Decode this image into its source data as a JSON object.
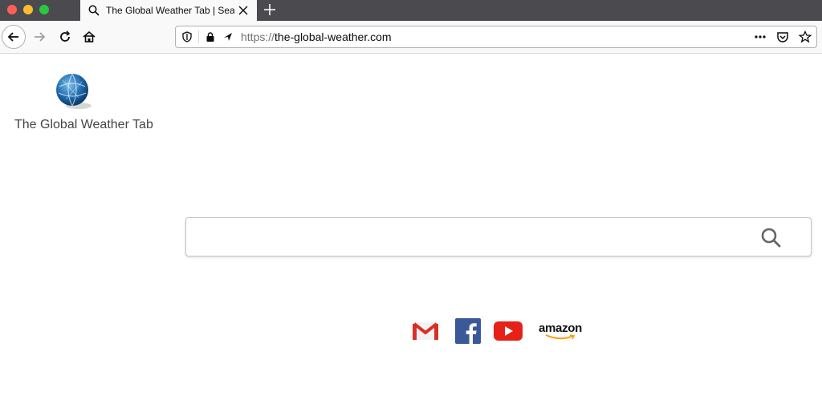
{
  "browser": {
    "tab": {
      "title": "The Global Weather Tab | Search",
      "icon": "search-icon"
    },
    "new_tab_icon": "plus-icon",
    "url": {
      "protocol": "https://",
      "host": "the-global-weather.com"
    },
    "nav_icons": [
      "back-arrow-icon",
      "forward-arrow-icon",
      "reload-icon",
      "home-icon"
    ],
    "url_icons": [
      "shield-icon",
      "lock-icon",
      "permissions-icon"
    ],
    "right_icons": [
      "more-actions-icon",
      "pocket-icon",
      "bookmark-star-icon"
    ]
  },
  "page": {
    "logo": {
      "name": "The Global Weather Tab",
      "icon": "globe-icon"
    },
    "search": {
      "placeholder": "",
      "value": "",
      "button_icon": "search-icon"
    },
    "shortcuts": [
      {
        "name": "Gmail",
        "icon": "gmail-icon",
        "color": "#d93025"
      },
      {
        "name": "Facebook",
        "icon": "facebook-icon",
        "color": "#3b5998"
      },
      {
        "name": "YouTube",
        "icon": "youtube-icon",
        "color": "#e62117"
      },
      {
        "name": "amazon",
        "icon": "amazon-icon",
        "label": "amazon",
        "color": "#ff9900"
      }
    ]
  }
}
